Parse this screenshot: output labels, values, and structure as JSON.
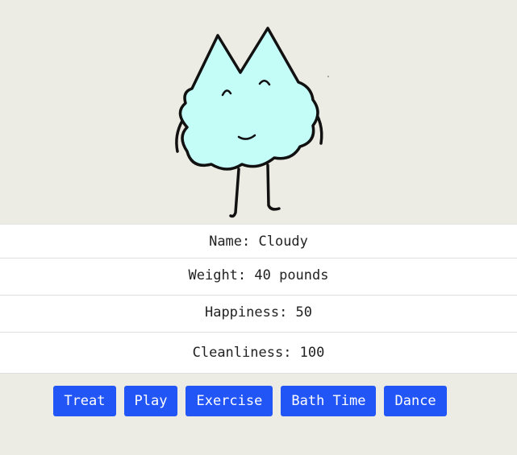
{
  "pet": {
    "name_text": "Name: Cloudy",
    "weight_text": "Weight: 40 pounds",
    "happiness_text": "Happiness: 50",
    "cleanliness_text": "Cleanliness: 100"
  },
  "actions": {
    "treat": "Treat",
    "play": "Play",
    "exercise": "Exercise",
    "bath": "Bath Time",
    "dance": "Dance"
  },
  "colors": {
    "background": "#ecece4",
    "pet_body": "#c4fcf8",
    "button": "#2255f5"
  },
  "icons": {
    "pet": "cloud-creature-illustration"
  }
}
